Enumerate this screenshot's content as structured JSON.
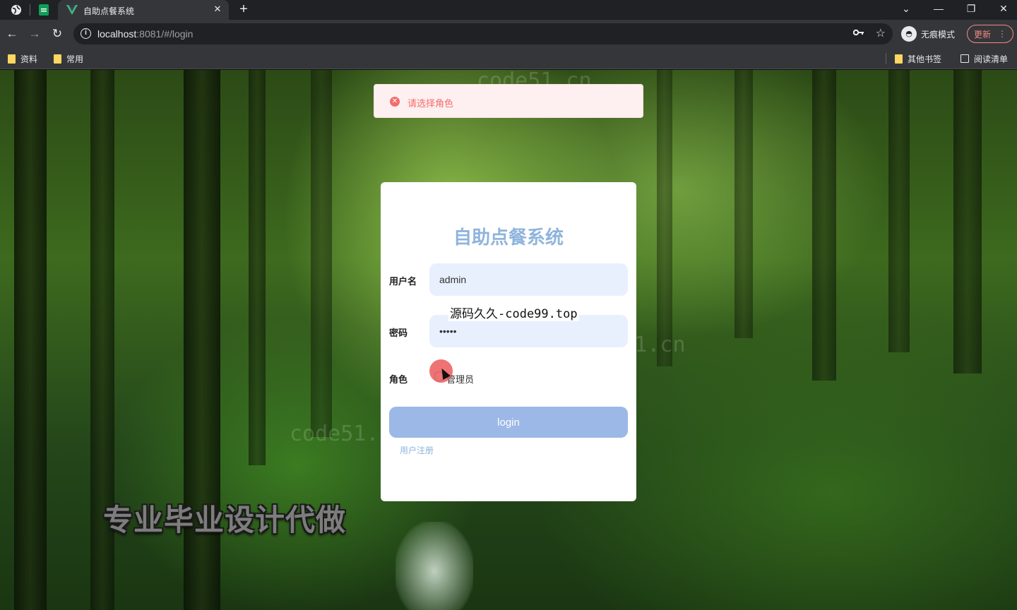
{
  "browser": {
    "tab": {
      "title": "自助点餐系统",
      "close_glyph": "✕"
    },
    "new_tab_glyph": "+",
    "url": {
      "host": "localhost",
      "rest": ":8081/#/login"
    },
    "incognito_label": "无痕模式",
    "update_label": "更新",
    "bookmarks": [
      "资料",
      "常用"
    ],
    "bookmarks_right": [
      "其他书签",
      "阅读清单"
    ]
  },
  "toast": {
    "message": "请选择角色",
    "type": "error",
    "color": "#f56c6c"
  },
  "login": {
    "title": "自助点餐系统",
    "username_label": "用户名",
    "username_value": "admin",
    "password_label": "密码",
    "password_value": "•••••",
    "role_label": "角色",
    "role_option": "管理员",
    "button_label": "login",
    "register_link": "用户注册",
    "accent_color": "#9bb8e6"
  },
  "overlays": {
    "source_text": "源码久久-code99.top",
    "promo_text": "专业毕业设计代做",
    "watermark": "code51.cn",
    "watermark_left": "cn"
  }
}
